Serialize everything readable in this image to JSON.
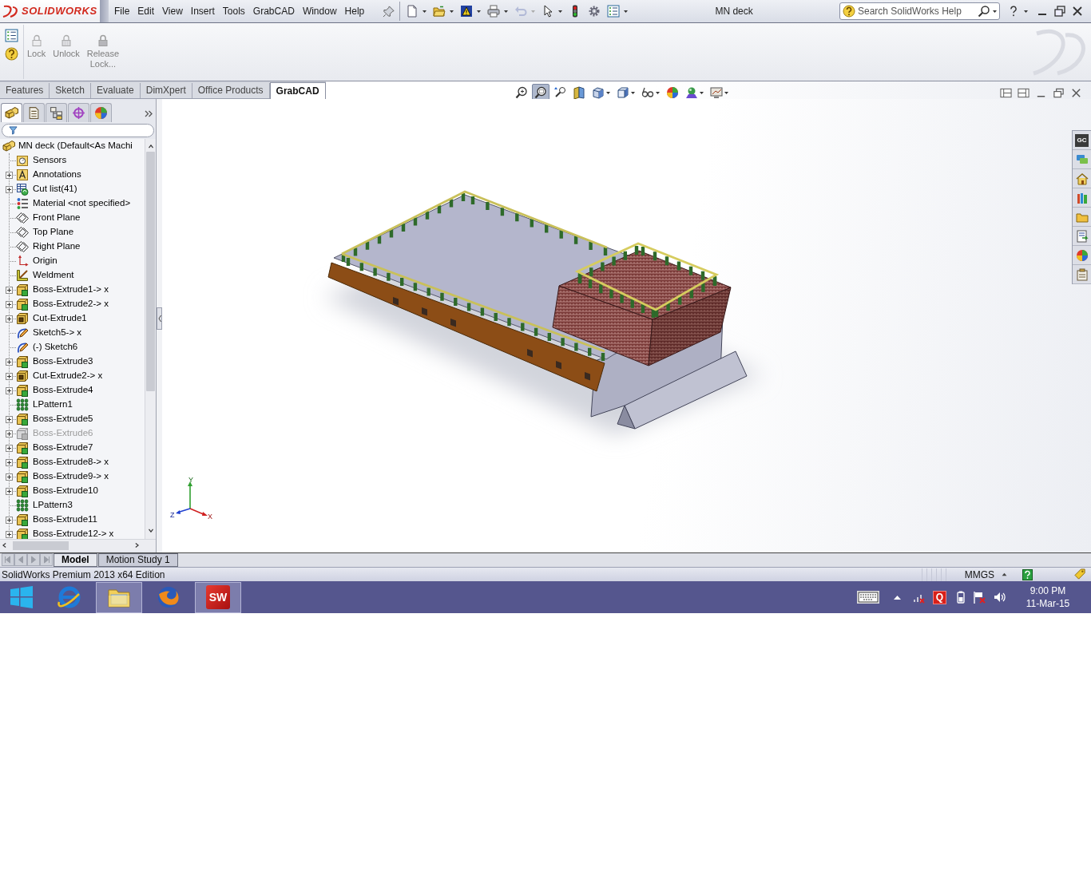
{
  "app_bar": {
    "logo_text": "SOLIDWORKS",
    "menus": [
      "File",
      "Edit",
      "View",
      "Insert",
      "Tools",
      "GrabCAD",
      "Window",
      "Help"
    ],
    "quick_access": [
      {
        "kind": "new",
        "disabled": false,
        "dropdown": true
      },
      {
        "kind": "open",
        "disabled": false,
        "dropdown": true
      },
      {
        "kind": "rebuild",
        "disabled": false,
        "dropdown": true
      },
      {
        "kind": "print",
        "disabled": false,
        "dropdown": true
      },
      {
        "kind": "undo",
        "disabled": true,
        "dropdown": true
      },
      {
        "kind": "select",
        "disabled": false,
        "dropdown": true
      },
      {
        "kind": "traffic_light",
        "disabled": false,
        "dropdown": false
      },
      {
        "kind": "options",
        "disabled": false,
        "dropdown": false
      },
      {
        "kind": "checklist",
        "disabled": false,
        "dropdown": true
      }
    ],
    "title": "MN deck",
    "search": {
      "placeholder": "Search SolidWorks Help"
    }
  },
  "ribbon": {
    "buttons": [
      {
        "kind": "lock",
        "label": "Lock",
        "disabled": true
      },
      {
        "kind": "unlock",
        "label": "Unlock",
        "disabled": true
      },
      {
        "kind": "release_lock",
        "label": "Release Lock...",
        "disabled": true
      }
    ]
  },
  "command_tabs": [
    {
      "label": "Features",
      "selected": false
    },
    {
      "label": "Sketch",
      "selected": false
    },
    {
      "label": "Evaluate",
      "selected": false
    },
    {
      "label": "DimXpert",
      "selected": false
    },
    {
      "label": "Office Products",
      "selected": false
    },
    {
      "label": "GrabCAD",
      "selected": true
    }
  ],
  "view_toolbar": [
    {
      "kind": "zoom_fit",
      "selected": false,
      "dropdown": false
    },
    {
      "kind": "zoom_area",
      "selected": true,
      "dropdown": false
    },
    {
      "kind": "previous_view",
      "selected": false,
      "dropdown": false
    },
    {
      "kind": "section",
      "selected": false,
      "dropdown": false
    },
    {
      "kind": "view_orientation",
      "selected": false,
      "dropdown": true
    },
    {
      "kind": "display_style",
      "selected": false,
      "dropdown": true
    },
    {
      "kind": "hide_show",
      "selected": false,
      "dropdown": true
    },
    {
      "kind": "appearance",
      "selected": false,
      "dropdown": false
    },
    {
      "kind": "scene",
      "selected": false,
      "dropdown": true
    },
    {
      "kind": "display_settings",
      "selected": false,
      "dropdown": true
    }
  ],
  "feature_manager": {
    "tabs": [
      {
        "kind": "feature",
        "selected": true
      },
      {
        "kind": "property",
        "selected": false
      },
      {
        "kind": "configuration",
        "selected": false
      },
      {
        "kind": "dimxpert",
        "selected": false
      },
      {
        "kind": "display",
        "selected": false
      }
    ],
    "tree": {
      "label": "MN deck (Default<As Machi",
      "kind": "part",
      "children": [
        {
          "label": "Sensors",
          "kind": "sensors",
          "expandable": false,
          "suppressed": false
        },
        {
          "label": "Annotations",
          "kind": "annotations",
          "expandable": true,
          "suppressed": false
        },
        {
          "label": "Cut list(41)",
          "kind": "cut_list",
          "expandable": true,
          "suppressed": false
        },
        {
          "label": "Material <not specified>",
          "kind": "material",
          "expandable": false,
          "suppressed": false
        },
        {
          "label": "Front Plane",
          "kind": "plane",
          "expandable": false,
          "suppressed": false
        },
        {
          "label": "Top Plane",
          "kind": "plane",
          "expandable": false,
          "suppressed": false
        },
        {
          "label": "Right Plane",
          "kind": "plane",
          "expandable": false,
          "suppressed": false
        },
        {
          "label": "Origin",
          "kind": "origin",
          "expandable": false,
          "suppressed": false
        },
        {
          "label": "Weldment",
          "kind": "weldment",
          "expandable": false,
          "suppressed": false
        },
        {
          "label": "Boss-Extrude1-> x",
          "kind": "boss_extrude",
          "expandable": true,
          "suppressed": false
        },
        {
          "label": "Boss-Extrude2-> x",
          "kind": "boss_extrude",
          "expandable": true,
          "suppressed": false
        },
        {
          "label": "Cut-Extrude1",
          "kind": "cut_extrude",
          "expandable": true,
          "suppressed": false
        },
        {
          "label": "Sketch5-> x",
          "kind": "sketch",
          "expandable": false,
          "suppressed": false
        },
        {
          "label": "(-) Sketch6",
          "kind": "sketch",
          "expandable": false,
          "suppressed": false
        },
        {
          "label": "Boss-Extrude3",
          "kind": "boss_extrude",
          "expandable": true,
          "suppressed": false
        },
        {
          "label": "Cut-Extrude2-> x",
          "kind": "cut_extrude",
          "expandable": true,
          "suppressed": false
        },
        {
          "label": "Boss-Extrude4",
          "kind": "boss_extrude",
          "expandable": true,
          "suppressed": false
        },
        {
          "label": "LPattern1",
          "kind": "pattern",
          "expandable": false,
          "suppressed": false
        },
        {
          "label": "Boss-Extrude5",
          "kind": "boss_extrude",
          "expandable": true,
          "suppressed": false
        },
        {
          "label": "Boss-Extrude6",
          "kind": "boss_extrude",
          "expandable": true,
          "suppressed": true
        },
        {
          "label": "Boss-Extrude7",
          "kind": "boss_extrude",
          "expandable": true,
          "suppressed": false
        },
        {
          "label": "Boss-Extrude8-> x",
          "kind": "boss_extrude",
          "expandable": true,
          "suppressed": false
        },
        {
          "label": "Boss-Extrude9-> x",
          "kind": "boss_extrude",
          "expandable": true,
          "suppressed": false
        },
        {
          "label": "Boss-Extrude10",
          "kind": "boss_extrude",
          "expandable": true,
          "suppressed": false
        },
        {
          "label": "LPattern3",
          "kind": "pattern",
          "expandable": false,
          "suppressed": false
        },
        {
          "label": "Boss-Extrude11",
          "kind": "boss_extrude",
          "expandable": true,
          "suppressed": false
        },
        {
          "label": "Boss-Extrude12-> x",
          "kind": "boss_extrude",
          "expandable": true,
          "suppressed": false
        }
      ]
    }
  },
  "triad": {
    "x": "X",
    "y": "Y",
    "z": "Z"
  },
  "task_pane": [
    {
      "kind": "grabcad",
      "label": "GC"
    },
    {
      "kind": "resources"
    },
    {
      "kind": "home"
    },
    {
      "kind": "library"
    },
    {
      "kind": "folder"
    },
    {
      "kind": "view_palette"
    },
    {
      "kind": "appearances"
    },
    {
      "kind": "custom_properties"
    }
  ],
  "bottom_tabs": [
    {
      "label": "Model",
      "selected": true
    },
    {
      "label": "Motion Study 1",
      "selected": false
    }
  ],
  "status_bar": {
    "text": "SolidWorks Premium 2013 x64 Edition",
    "units": "MMGS"
  },
  "taskbar": {
    "apps": [
      {
        "kind": "start",
        "active": false
      },
      {
        "kind": "browser",
        "active": false
      },
      {
        "kind": "explorer",
        "active": true
      },
      {
        "kind": "firefox",
        "active": false
      },
      {
        "kind": "solidworks",
        "active": true,
        "label": "SW"
      }
    ],
    "tray": [
      {
        "kind": "keyboard"
      },
      {
        "kind": "show_hidden"
      },
      {
        "kind": "network"
      },
      {
        "kind": "app",
        "label": "Q"
      },
      {
        "kind": "battery"
      },
      {
        "kind": "flag"
      },
      {
        "kind": "volume"
      }
    ],
    "time": "9:00 PM",
    "date": "11-Mar-15"
  }
}
